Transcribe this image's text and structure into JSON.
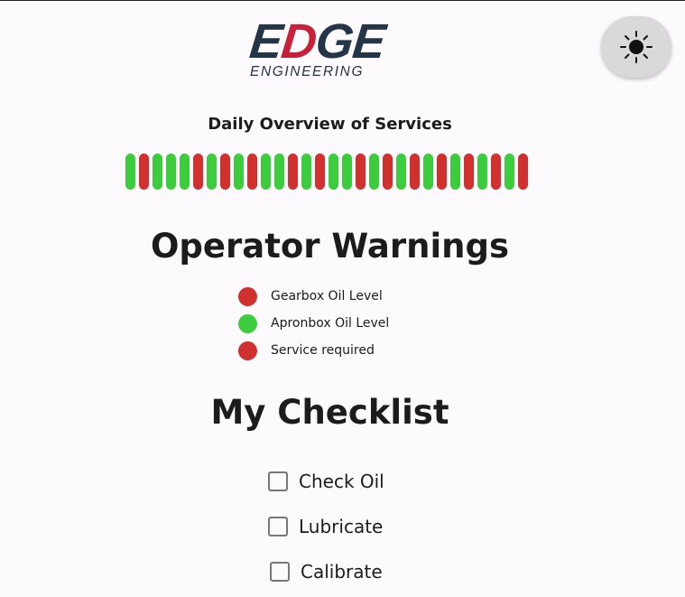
{
  "brand": {
    "wordmark_prefix": "E",
    "wordmark_accent": "D",
    "wordmark_suffix": "GE",
    "tagline": "ENGINEERING",
    "color_primary": "#253548",
    "color_accent": "#c8203a"
  },
  "theme_toggle": {
    "icon": "sun-icon"
  },
  "overview": {
    "title": "Daily Overview of Services",
    "color_ok": "#3dcc3d",
    "color_alert": "#d0302e",
    "statuses": [
      "green",
      "red",
      "green",
      "green",
      "green",
      "red",
      "green",
      "red",
      "green",
      "red",
      "green",
      "green",
      "red",
      "green",
      "red",
      "green",
      "green",
      "red",
      "green",
      "red",
      "green",
      "red",
      "green",
      "red",
      "green",
      "red",
      "green",
      "red",
      "green",
      "red"
    ]
  },
  "warnings": {
    "title": "Operator Warnings",
    "items": [
      {
        "label": "Gearbox Oil Level",
        "status": "red"
      },
      {
        "label": "Apronbox Oil Level",
        "status": "green"
      },
      {
        "label": "Service required",
        "status": "red"
      }
    ]
  },
  "checklist": {
    "title": "My Checklist",
    "items": [
      {
        "label": "Check Oil",
        "checked": false
      },
      {
        "label": "Lubricate",
        "checked": false
      },
      {
        "label": "Calibrate",
        "checked": false
      }
    ]
  }
}
